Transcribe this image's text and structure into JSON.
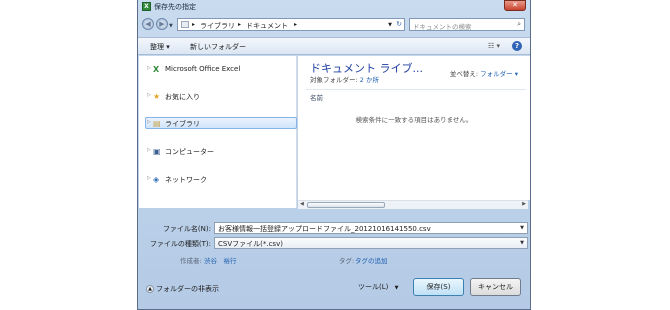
{
  "window": {
    "title": "保存先の指定",
    "close": "✕"
  },
  "address": {
    "crumbs": [
      "ライブラリ",
      "ドキュメント"
    ],
    "search_placeholder": "ドキュメントの検索"
  },
  "toolbar": {
    "organize": "整理 ▾",
    "new_folder": "新しいフォルダー"
  },
  "nav": [
    {
      "label": "Microsoft Office Excel",
      "icon": "excel-icon"
    },
    {
      "label": "お気に入り",
      "icon": "star-icon"
    },
    {
      "label": "ライブラリ",
      "icon": "library-icon"
    },
    {
      "label": "コンピューター",
      "icon": "computer-icon"
    },
    {
      "label": "ネットワーク",
      "icon": "network-icon"
    }
  ],
  "content": {
    "title": "ドキュメント ライブ...",
    "target_prefix": "対象フォルダー: ",
    "target_link": "2 か所",
    "arrange_label": "並べ替え: ",
    "arrange_value": "フォルダー ▾",
    "column_name": "名前",
    "empty_message": "検索条件に一致する項目はありません。"
  },
  "form": {
    "filename_label": "ファイル名(N):",
    "filename_value": "お客様情報一括登録アップロードファイル_20121016141550.csv",
    "filetype_label": "ファイルの種類(T):",
    "filetype_value": "CSVファイル(*.csv)",
    "author_label": "作成者:",
    "author_value": "渋谷　裕行",
    "tag_label": "タグ:",
    "tag_value": "タグの追加"
  },
  "footer": {
    "hide_folders": "フォルダーの非表示",
    "tools": "ツール(L)",
    "save": "保存(S)",
    "cancel": "キャンセル"
  }
}
